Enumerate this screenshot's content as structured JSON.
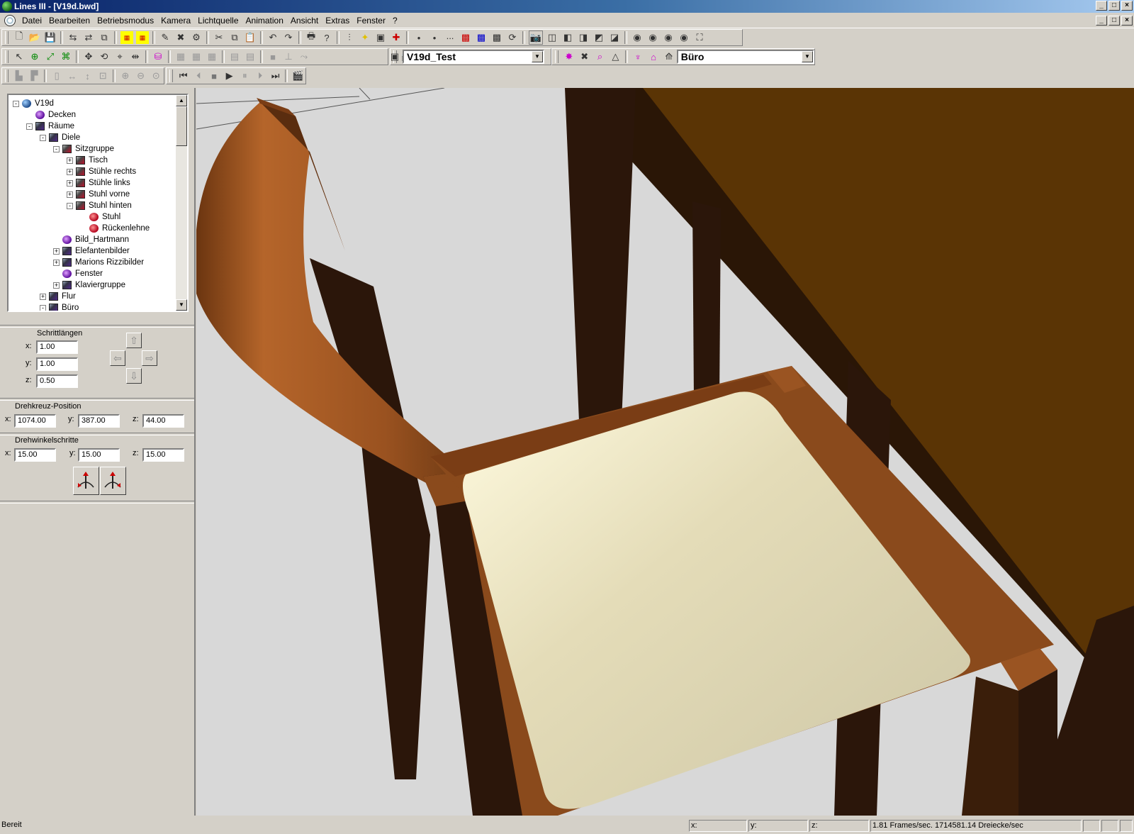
{
  "window": {
    "title": "Lines III - [V19d.bwd]"
  },
  "menu": [
    "Datei",
    "Bearbeiten",
    "Betriebsmodus",
    "Kamera",
    "Lichtquelle",
    "Animation",
    "Ansicht",
    "Extras",
    "Fenster",
    "?"
  ],
  "toolbar": {
    "scene_combo": "V19d_Test",
    "room_combo": "Büro"
  },
  "tree": [
    {
      "label": "V19d",
      "level": 0,
      "icon": "globe-icon",
      "toggle": "-"
    },
    {
      "label": "Decken",
      "level": 1,
      "icon": "light-icon",
      "toggle": ""
    },
    {
      "label": "Räume",
      "level": 1,
      "icon": "group-icon",
      "toggle": "-"
    },
    {
      "label": "Diele",
      "level": 2,
      "icon": "group-icon",
      "toggle": "-"
    },
    {
      "label": "Sitzgruppe",
      "level": 3,
      "icon": "group-red-icon",
      "toggle": "-"
    },
    {
      "label": "Tisch",
      "level": 4,
      "icon": "group-red-icon",
      "toggle": "+"
    },
    {
      "label": "Stühle rechts",
      "level": 4,
      "icon": "group-red-icon",
      "toggle": "+"
    },
    {
      "label": "Stühle links",
      "level": 4,
      "icon": "group-red-icon",
      "toggle": "+"
    },
    {
      "label": "Stuhl vorne",
      "level": 4,
      "icon": "group-red-icon",
      "toggle": "+"
    },
    {
      "label": "Stuhl hinten",
      "level": 4,
      "icon": "group-red-icon",
      "toggle": "-"
    },
    {
      "label": "Stuhl",
      "level": 5,
      "icon": "object-icon",
      "toggle": ""
    },
    {
      "label": "Rückenlehne",
      "level": 5,
      "icon": "object-icon",
      "toggle": ""
    },
    {
      "label": "Bild_Hartmann",
      "level": 3,
      "icon": "light-icon",
      "toggle": ""
    },
    {
      "label": "Elefantenbilder",
      "level": 3,
      "icon": "group-icon",
      "toggle": "+"
    },
    {
      "label": "Marions Rizzibilder",
      "level": 3,
      "icon": "group-icon",
      "toggle": "+"
    },
    {
      "label": "Fenster",
      "level": 3,
      "icon": "light-icon",
      "toggle": ""
    },
    {
      "label": "Klaviergruppe",
      "level": 3,
      "icon": "group-icon",
      "toggle": "+"
    },
    {
      "label": "Flur",
      "level": 2,
      "icon": "group-icon",
      "toggle": "+"
    },
    {
      "label": "Büro",
      "level": 2,
      "icon": "group-icon",
      "toggle": "-"
    }
  ],
  "steps": {
    "title": "Schrittlängen",
    "x_label": "x:",
    "y_label": "y:",
    "z_label": "z:",
    "x": "1.00",
    "y": "1.00",
    "z": "0.50"
  },
  "pivot": {
    "title": "Drehkreuz-Position",
    "x_label": "x:",
    "y_label": "y:",
    "z_label": "z:",
    "x": "1074.00",
    "y": "387.00",
    "z": "44.00"
  },
  "rotation": {
    "title": "Drehwinkelschritte",
    "x_label": "x:",
    "y_label": "y:",
    "z_label": "z:",
    "x": "15.00",
    "y": "15.00",
    "z": "15.00"
  },
  "status": {
    "ready": "Bereit",
    "x": "x:",
    "y": "y:",
    "z": "z:",
    "perf": "1.81 Frames/sec. 1714581.14 Dreiecke/sec"
  },
  "colors": {
    "wood": "#8a4a1c",
    "wood_dark": "#2b160a",
    "table": "#5a3405",
    "cushion": "#e5dfc0",
    "floor": "#d8d8d8"
  }
}
